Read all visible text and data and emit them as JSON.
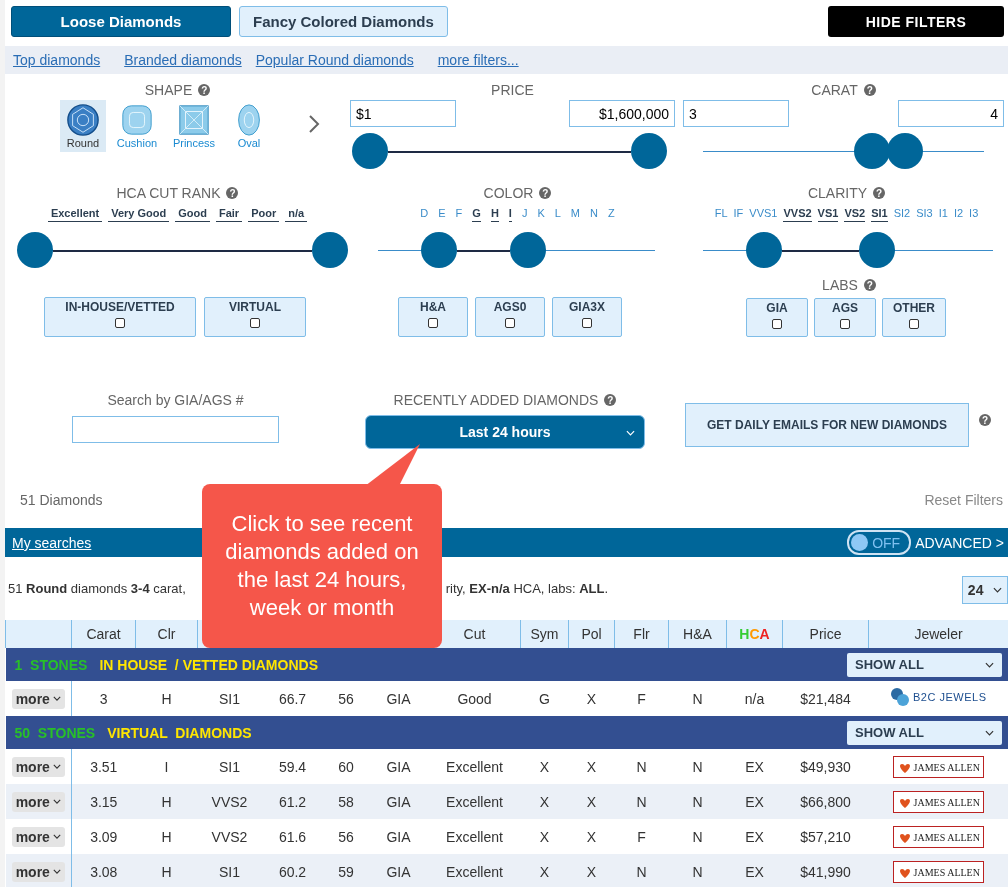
{
  "tabs": [
    {
      "label": "Loose Diamonds",
      "selected": true
    },
    {
      "label": "Fancy Colored Diamonds",
      "selected": false
    }
  ],
  "hide_filters": "HIDE FILTERS",
  "quick_links": [
    "Top diamonds",
    "Branded diamonds",
    "Popular Round diamonds",
    "more filters..."
  ],
  "shape": {
    "title": "SHAPE",
    "help": "?",
    "items": [
      {
        "label": "Round",
        "kind": "round",
        "selected": true
      },
      {
        "label": "Cushion",
        "kind": "cushion",
        "selected": false
      },
      {
        "label": "Princess",
        "kind": "princess",
        "selected": false
      },
      {
        "label": "Oval",
        "kind": "oval",
        "selected": false
      }
    ]
  },
  "price": {
    "title": "PRICE",
    "min": "$1",
    "max": "$1,600,000",
    "thumbs": [
      {
        "level": 0
      },
      {
        "level": 1
      }
    ]
  },
  "carat": {
    "title": "CARAT",
    "help": "?",
    "min": "3",
    "max": "4",
    "thumbs": [
      {
        "level": 0.6
      },
      {
        "level": 0.72
      }
    ]
  },
  "hca": {
    "title": "HCA CUT RANK",
    "help": "?",
    "grades": [
      {
        "label": "Excellent",
        "selected": true
      },
      {
        "label": "Very Good",
        "selected": true
      },
      {
        "label": "Good",
        "selected": true
      },
      {
        "label": "Fair",
        "selected": true
      },
      {
        "label": "Poor",
        "selected": true
      },
      {
        "label": "n/a",
        "selected": true
      }
    ],
    "thumbs": [
      {
        "level": 0
      },
      {
        "level": 1
      }
    ]
  },
  "color": {
    "title": "COLOR",
    "help": "?",
    "grades": [
      {
        "label": "D",
        "selected": false
      },
      {
        "label": "E",
        "selected": false
      },
      {
        "label": "F",
        "selected": false
      },
      {
        "label": "G",
        "selected": true
      },
      {
        "label": "H",
        "selected": true
      },
      {
        "label": "I",
        "selected": true
      },
      {
        "label": "J",
        "selected": false
      },
      {
        "label": "K",
        "selected": false
      },
      {
        "label": "L",
        "selected": false
      },
      {
        "label": "M",
        "selected": false
      },
      {
        "label": "N",
        "selected": false
      },
      {
        "label": "Z",
        "selected": false
      }
    ],
    "thumbs": [
      {
        "level": 0.22
      },
      {
        "level": 0.54
      }
    ]
  },
  "clarity": {
    "title": "CLARITY",
    "help": "?",
    "grades": [
      {
        "label": "FL",
        "selected": false
      },
      {
        "label": "IF",
        "selected": false
      },
      {
        "label": "VVS1",
        "selected": false
      },
      {
        "label": "VVS2",
        "selected": true
      },
      {
        "label": "VS1",
        "selected": true
      },
      {
        "label": "VS2",
        "selected": true
      },
      {
        "label": "SI1",
        "selected": true
      },
      {
        "label": "SI2",
        "selected": false
      },
      {
        "label": "SI3",
        "selected": false
      },
      {
        "label": "I1",
        "selected": false
      },
      {
        "label": "I2",
        "selected": false
      },
      {
        "label": "I3",
        "selected": false
      }
    ],
    "thumbs": [
      {
        "level": 0.21
      },
      {
        "level": 0.6
      }
    ]
  },
  "source_filters": [
    {
      "label": "IN-HOUSE/VETTED",
      "checked": false
    },
    {
      "label": "VIRTUAL",
      "checked": false
    }
  ],
  "cut_filters": [
    {
      "label": "H&A",
      "checked": false
    },
    {
      "label": "AGS0",
      "checked": false
    },
    {
      "label": "GIA3X",
      "checked": false
    }
  ],
  "labs": {
    "title": "LABS",
    "help": "?",
    "items": [
      {
        "label": "GIA",
        "checked": false
      },
      {
        "label": "AGS",
        "checked": false
      },
      {
        "label": "OTHER",
        "checked": false
      }
    ]
  },
  "search": {
    "label": "Search by GIA/AGS #"
  },
  "recent": {
    "title": "RECENTLY ADDED DIAMONDS",
    "help": "?",
    "value": "Last 24 hours"
  },
  "email_button": "GET DAILY EMAILS FOR NEW DIAMONDS",
  "email_help": "?",
  "count": "51 Diamonds",
  "reset": "Reset Filters",
  "bar": {
    "my_searches": "My searches",
    "toggle": {
      "label": "OFF",
      "on": false
    },
    "advanced": "ADVANCED >"
  },
  "summary": [
    "51 **Round** diamonds **3-4** carat,",
    "rity, **EX-n/a** HCA, labs: **ALL**."
  ],
  "per_page": "24",
  "callout": "Click to see recent diamonds added on the last 24 hours, week or month",
  "table": {
    "columns_left": [
      "Carat",
      "Clr"
    ],
    "columns_right": [
      "Cut",
      "Sym",
      "Pol",
      "Flr",
      "H&A"
    ],
    "hca_header": [
      {
        "text": "H",
        "color": "#33cc33"
      },
      {
        "text": "C",
        "color": "#ff9900"
      },
      {
        "text": "A",
        "color": "#ee2222"
      }
    ],
    "columns_end": [
      "Price",
      "Jeweler"
    ],
    "groups": [
      {
        "count": "1  STONES",
        "title": "IN HOUSE  / VETTED DIAMONDS",
        "show_all": "SHOW ALL",
        "rows": [
          {
            "more": "more",
            "cells": [
              "3",
              "H",
              "SI1",
              "66.7",
              "56",
              "GIA",
              "Good",
              "G",
              "X",
              "F",
              "N",
              "n/a",
              "$21,484"
            ],
            "jeweler": {
              "kind": "b2c",
              "name": "B2C JEWELS"
            }
          }
        ]
      },
      {
        "count": "50  STONES",
        "title": "VIRTUAL  DIAMONDS",
        "show_all": "SHOW ALL",
        "rows": [
          {
            "more": "more",
            "cells": [
              "3.51",
              "I",
              "SI1",
              "59.4",
              "60",
              "GIA",
              "Excellent",
              "X",
              "X",
              "N",
              "N",
              "EX",
              "$49,930"
            ],
            "jeweler": {
              "kind": "ja",
              "name": "JAMES ALLEN"
            }
          },
          {
            "more": "more",
            "cells": [
              "3.15",
              "H",
              "VVS2",
              "61.2",
              "58",
              "GIA",
              "Excellent",
              "X",
              "X",
              "N",
              "N",
              "EX",
              "$66,800"
            ],
            "jeweler": {
              "kind": "ja",
              "name": "JAMES ALLEN"
            }
          },
          {
            "more": "more",
            "cells": [
              "3.09",
              "H",
              "VVS2",
              "61.6",
              "56",
              "GIA",
              "Excellent",
              "X",
              "X",
              "F",
              "N",
              "EX",
              "$57,210"
            ],
            "jeweler": {
              "kind": "ja",
              "name": "JAMES ALLEN"
            }
          },
          {
            "more": "more",
            "cells": [
              "3.08",
              "H",
              "SI1",
              "60.2",
              "59",
              "GIA",
              "Excellent",
              "X",
              "X",
              "N",
              "N",
              "EX",
              "$41,990"
            ],
            "jeweler": {
              "kind": "ja",
              "name": "JAMES ALLEN"
            }
          }
        ]
      }
    ]
  }
}
